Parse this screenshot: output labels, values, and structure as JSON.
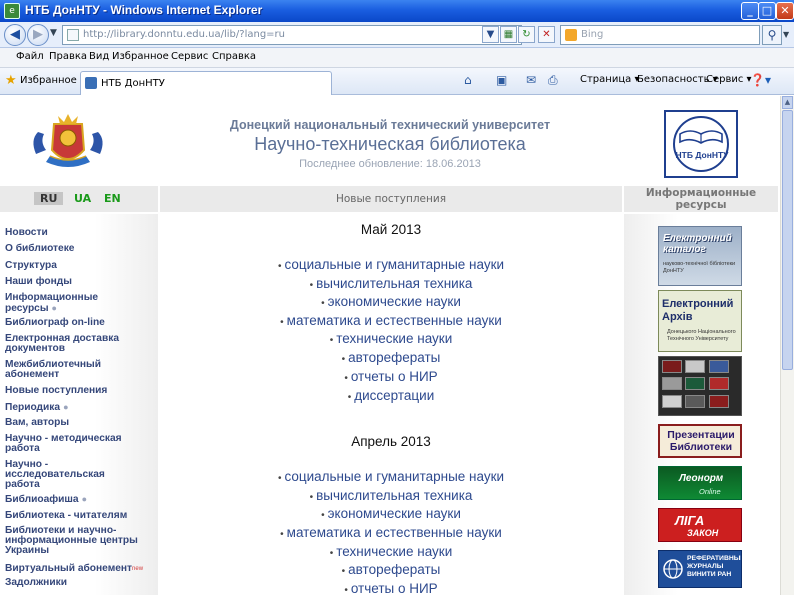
{
  "window": {
    "title": "НТБ ДонНТУ - Windows Internet Explorer",
    "app_icon": "ie-page-icon",
    "buttons": {
      "minimize": "_",
      "maximize": "□",
      "close": "✕"
    }
  },
  "address_bar": {
    "url": "http://library.donntu.edu.ua/lib/?lang=ru",
    "search_placeholder": "Bing",
    "back_glyph": "◀",
    "forward_glyph": "▶",
    "refresh_glyph": "↻",
    "stop_glyph": "✕",
    "search_glyph": "⚲"
  },
  "menu": [
    "Файл",
    "Правка",
    "Вид",
    "Избранное",
    "Сервис",
    "Справка"
  ],
  "favorites_bar": {
    "favorites_label": "Избранное",
    "tab_label": "НТБ ДонНТУ",
    "commands": [
      "Страница",
      "Безопасность",
      "Сервис"
    ]
  },
  "site": {
    "university": "Донецкий национальный технический университет",
    "library": "Научно-техническая библиотека",
    "last_update": "Последнее обновление: 18.06.2013",
    "languages": [
      "RU",
      "UA",
      "EN"
    ],
    "center_header": "Новые поступления",
    "right_header": "Информационные ресурсы"
  },
  "nav": [
    "Новости",
    "О библиотеке",
    "Структура",
    "Наши фонды",
    "Информационные ресурсы",
    "Библиограф on-line",
    "Електронная доставка документов",
    "Межбиблиотечный абонемент",
    "Новые поступления",
    "Периодика",
    "Вам, авторы",
    "Научно - методическая работа",
    "Научно - исследовательская работа",
    "Библиоафиша",
    "Библиотека - читателям",
    "Библиотеки и научно-информационные центры Украины",
    "Виртуальный абонемент",
    "Задолжники"
  ],
  "nav_new_badge": "new",
  "months": [
    {
      "title": "Май 2013",
      "subjects": [
        "социальные и гуманитарные науки",
        "вычислительная техника",
        "экономические науки",
        "математика и естественные науки",
        "технические науки",
        "авторефераты",
        "отчеты о НИР",
        "диссертации"
      ]
    },
    {
      "title": "Апрель 2013",
      "subjects": [
        "социальные и гуманитарные науки",
        "вычислительная техника",
        "экономические науки",
        "математика и естественные науки",
        "технические науки",
        "авторефераты",
        "отчеты о НИР"
      ]
    }
  ],
  "banners": {
    "catalog_title": "Електронний каталог",
    "catalog_sub": "науково-технічної бібліотеки ДонНТУ",
    "archive_title": "Електронний Архів",
    "archive_sub": "Донецького Національного Технічного Університету",
    "presentations": "Презентации Библиотеки",
    "leonorm_title": "Леонорм",
    "leonorm_sub": "Online",
    "liga_title": "ЛІГА",
    "liga_sub": "ЗАКОН",
    "referative": "РЕФЕРАТИВНЫЕ ЖУРНАЛЫ ВИНИТИ РАН"
  },
  "logo_right_text": "НТБ ДонНТУ"
}
